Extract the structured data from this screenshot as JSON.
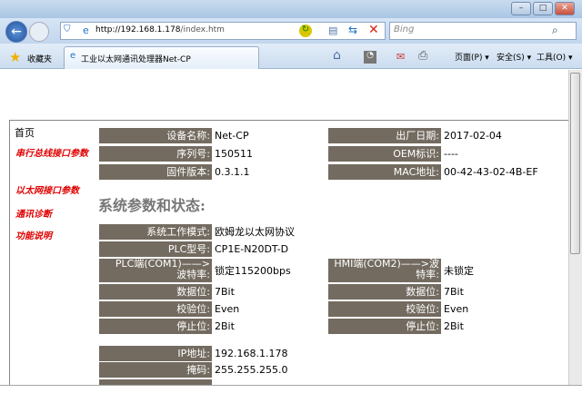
{
  "browser": {
    "url_host": "http://192.168.1.178",
    "url_path": "/index.htm",
    "search_placeholder": "Bing",
    "favorites": "收藏夹",
    "tab_title": "工业以太网通讯处理器Net-CP",
    "menu_page": "页面(P) ▾",
    "menu_safety": "安全(S) ▾",
    "menu_tools": "工具(O) ▾"
  },
  "sidebar": {
    "home": "首页",
    "links": [
      "串行总线接口参数",
      "以太网接口参数",
      "通讯诊断",
      "功能说明"
    ]
  },
  "device": {
    "rows": [
      {
        "label": "设备名称:",
        "value": "Net-CP"
      },
      {
        "label": "序列号:",
        "value": "150511"
      },
      {
        "label": "固件版本:",
        "value": "0.3.1.1"
      }
    ],
    "right": [
      {
        "label": "出厂日期:",
        "value": "2017-02-04"
      },
      {
        "label": "OEM标识:",
        "value": "----"
      },
      {
        "label": "MAC地址:",
        "value": "00-42-43-02-4B-EF"
      }
    ]
  },
  "system": {
    "heading": "系统参数和状态:",
    "mode_label": "系统工作模式:",
    "mode_value": "欧姆龙以太网协议",
    "plc_label": "PLC型号:",
    "plc_value": "CP1E-N20DT-D",
    "com1_label": "PLC端(COM1)——>波特率:",
    "com1_value": "锁定115200bps",
    "com2_label": "HMI端(COM2)——>波特率:",
    "com2_value": "未锁定",
    "left": [
      {
        "label": "数据位:",
        "value": "7Bit"
      },
      {
        "label": "校验位:",
        "value": "Even"
      },
      {
        "label": "停止位:",
        "value": "2Bit"
      }
    ],
    "right": [
      {
        "label": "数据位:",
        "value": "7Bit"
      },
      {
        "label": "校验位:",
        "value": "Even"
      },
      {
        "label": "停止位:",
        "value": "2Bit"
      }
    ],
    "net": [
      {
        "label": "IP地址:",
        "value": "192.168.1.178"
      },
      {
        "label": "掩码:",
        "value": "255.255.255.0"
      }
    ]
  }
}
